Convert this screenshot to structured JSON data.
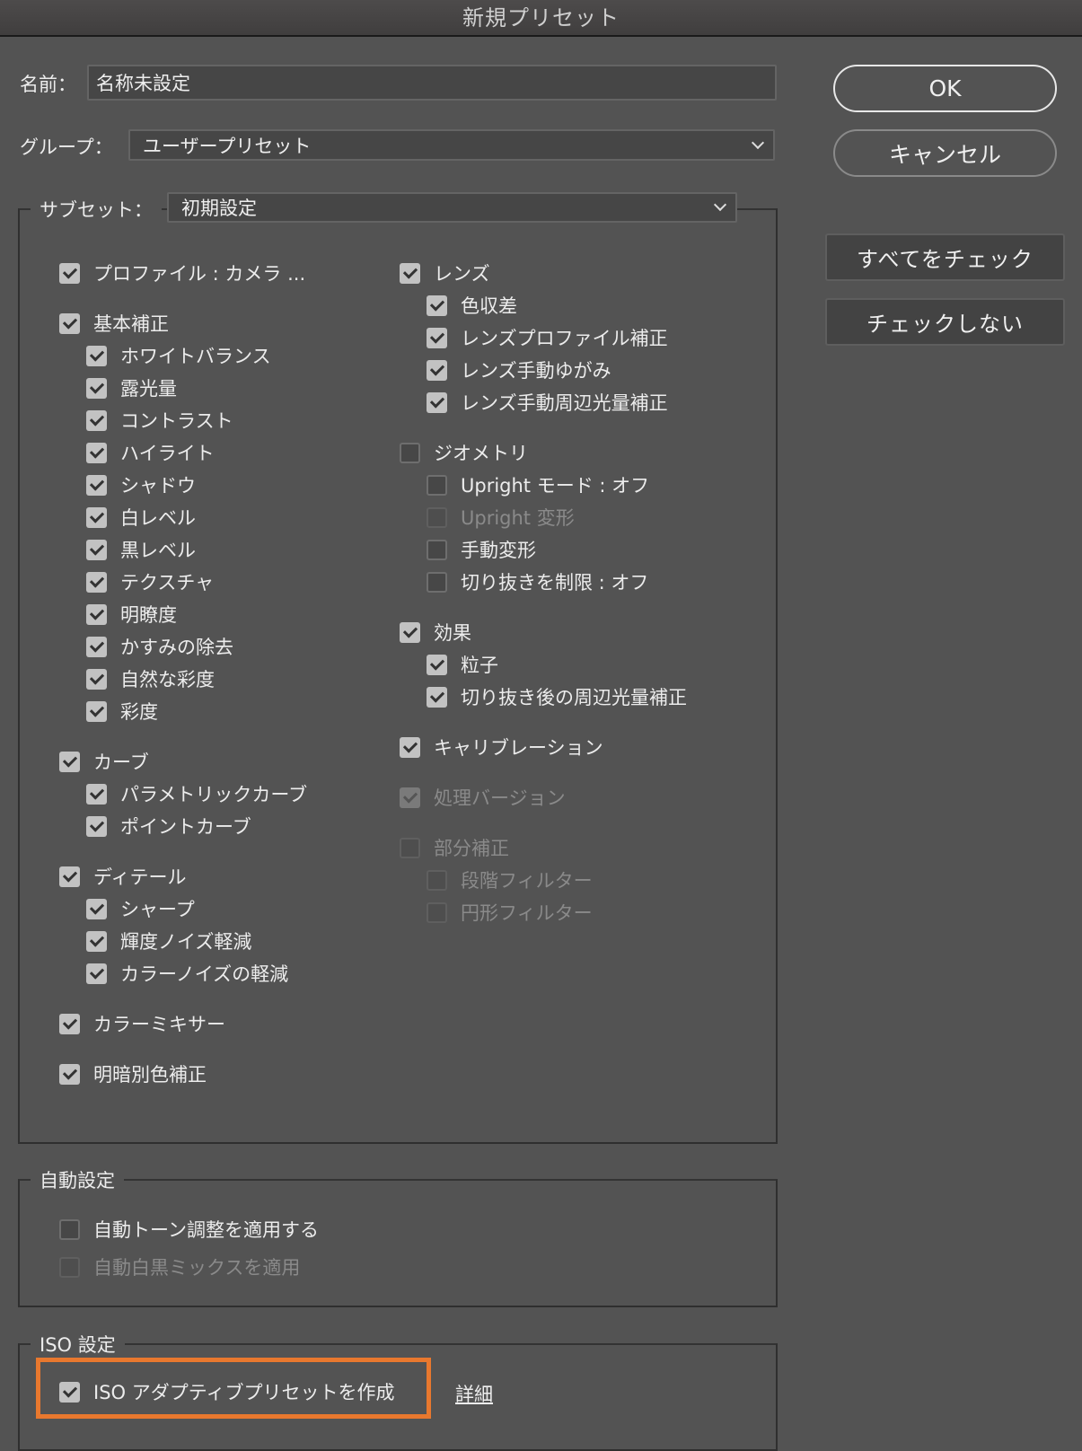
{
  "window": {
    "title": "新規プリセット"
  },
  "name": {
    "label": "名前：",
    "value": "名称未設定"
  },
  "group": {
    "label": "グループ：",
    "value": "ユーザープリセット"
  },
  "subset": {
    "label": "サブセット：",
    "value": "初期設定"
  },
  "buttons": {
    "ok": "OK",
    "cancel": "キャンセル",
    "check_all": "すべてをチェック",
    "check_none": "チェックしない"
  },
  "columns": [
    [
      {
        "label": "プロファイル : カメラ ...",
        "checked": true,
        "level": 0,
        "group_start": true
      },
      {
        "label": "基本補正",
        "checked": true,
        "level": 0,
        "group_start": true
      },
      {
        "label": "ホワイトバランス",
        "checked": true,
        "level": 1
      },
      {
        "label": "露光量",
        "checked": true,
        "level": 1
      },
      {
        "label": "コントラスト",
        "checked": true,
        "level": 1
      },
      {
        "label": "ハイライト",
        "checked": true,
        "level": 1
      },
      {
        "label": "シャドウ",
        "checked": true,
        "level": 1
      },
      {
        "label": "白レベル",
        "checked": true,
        "level": 1
      },
      {
        "label": "黒レベル",
        "checked": true,
        "level": 1
      },
      {
        "label": "テクスチャ",
        "checked": true,
        "level": 1
      },
      {
        "label": "明瞭度",
        "checked": true,
        "level": 1
      },
      {
        "label": "かすみの除去",
        "checked": true,
        "level": 1
      },
      {
        "label": "自然な彩度",
        "checked": true,
        "level": 1
      },
      {
        "label": "彩度",
        "checked": true,
        "level": 1
      },
      {
        "label": "カーブ",
        "checked": true,
        "level": 0,
        "group_start": true
      },
      {
        "label": "パラメトリックカーブ",
        "checked": true,
        "level": 1
      },
      {
        "label": "ポイントカーブ",
        "checked": true,
        "level": 1
      },
      {
        "label": "ディテール",
        "checked": true,
        "level": 0,
        "group_start": true
      },
      {
        "label": "シャープ",
        "checked": true,
        "level": 1
      },
      {
        "label": "輝度ノイズ軽減",
        "checked": true,
        "level": 1
      },
      {
        "label": "カラーノイズの軽減",
        "checked": true,
        "level": 1
      },
      {
        "label": "カラーミキサー",
        "checked": true,
        "level": 0,
        "group_start": true
      },
      {
        "label": "明暗別色補正",
        "checked": true,
        "level": 0,
        "group_start": true
      }
    ],
    [
      {
        "label": "レンズ",
        "checked": true,
        "level": 0,
        "group_start": true
      },
      {
        "label": "色収差",
        "checked": true,
        "level": 1
      },
      {
        "label": "レンズプロファイル補正",
        "checked": true,
        "level": 1
      },
      {
        "label": "レンズ手動ゆがみ",
        "checked": true,
        "level": 1
      },
      {
        "label": "レンズ手動周辺光量補正",
        "checked": true,
        "level": 1
      },
      {
        "label": "ジオメトリ",
        "checked": false,
        "level": 0,
        "group_start": true
      },
      {
        "label": "Upright モード : オフ",
        "checked": false,
        "level": 1
      },
      {
        "label": "Upright 変形",
        "checked": false,
        "level": 1,
        "disabled": true
      },
      {
        "label": "手動変形",
        "checked": false,
        "level": 1
      },
      {
        "label": "切り抜きを制限 : オフ",
        "checked": false,
        "level": 1
      },
      {
        "label": "効果",
        "checked": true,
        "level": 0,
        "group_start": true
      },
      {
        "label": "粒子",
        "checked": true,
        "level": 1
      },
      {
        "label": "切り抜き後の周辺光量補正",
        "checked": true,
        "level": 1
      },
      {
        "label": "キャリブレーション",
        "checked": true,
        "level": 0,
        "group_start": true
      },
      {
        "label": "処理バージョン",
        "checked": true,
        "level": 0,
        "group_start": true,
        "disabled": true
      },
      {
        "label": "部分補正",
        "checked": false,
        "level": 0,
        "group_start": true,
        "disabled": true
      },
      {
        "label": "段階フィルター",
        "checked": false,
        "level": 1,
        "disabled": true
      },
      {
        "label": "円形フィルター",
        "checked": false,
        "level": 1,
        "disabled": true
      }
    ]
  ],
  "auto": {
    "title": "自動設定",
    "items": [
      {
        "label": "自動トーン調整を適用する",
        "checked": false
      },
      {
        "label": "自動白黒ミックスを適用",
        "checked": false,
        "disabled": true
      }
    ]
  },
  "iso": {
    "title": "ISO 設定",
    "item": {
      "label": "ISO アダプティブプリセットを作成",
      "checked": true
    },
    "details_link": "詳細",
    "highlight_color": "#e8782e"
  }
}
